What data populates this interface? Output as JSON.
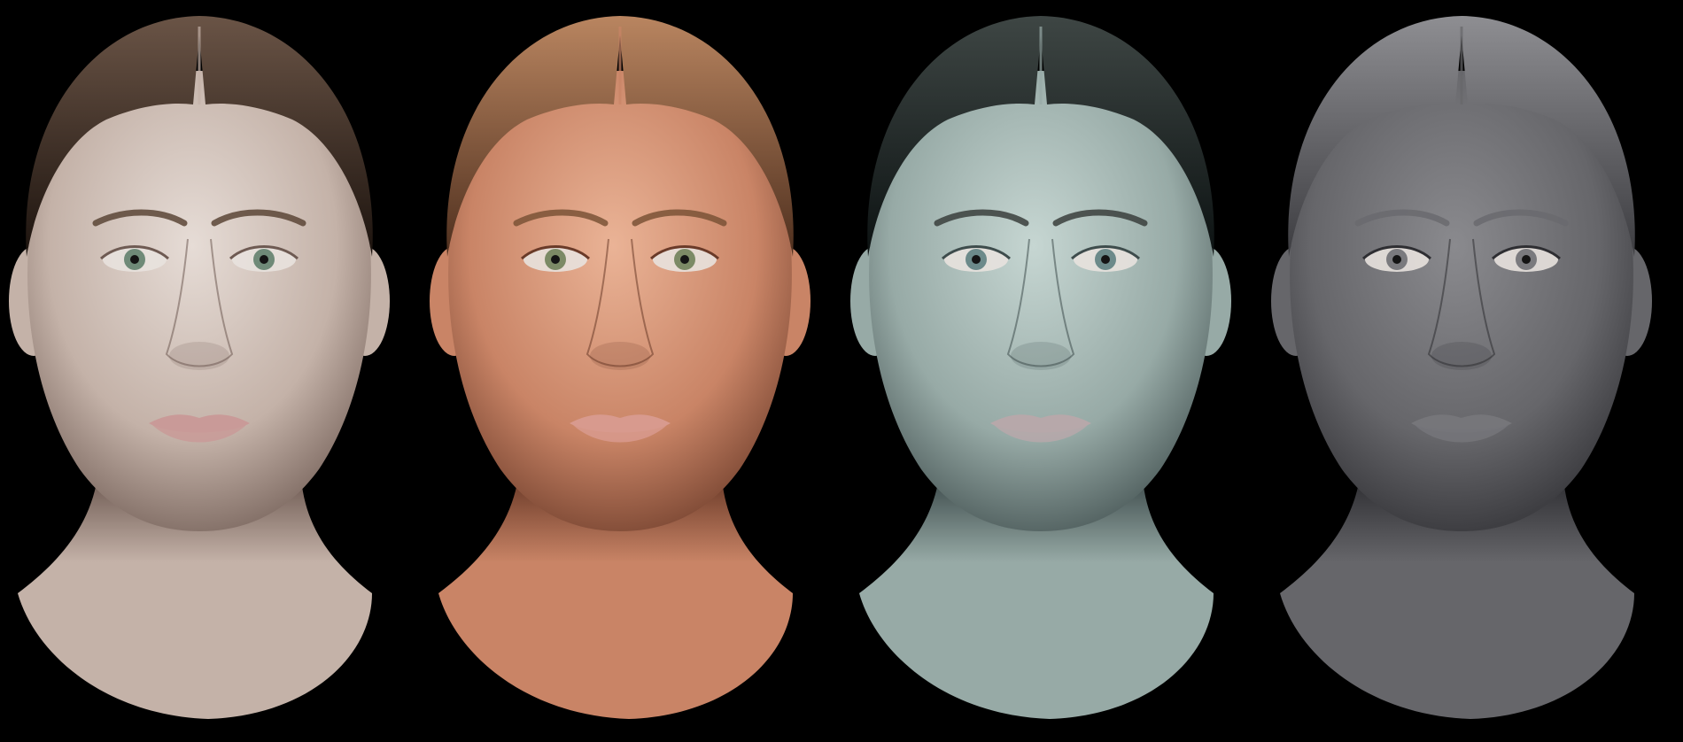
{
  "scene": {
    "background_color": "#000000",
    "panels": [
      {
        "variant": "neutral-lit",
        "skin_light": "#e6dcd6",
        "skin_mid": "#c4b2a8",
        "skin_dark": "#6e5a52",
        "hair_light": "#6a5446",
        "hair_dark": "#1c130e",
        "lip": "#c99a98",
        "iris": "#6f8a78",
        "brow": "#5a4536"
      },
      {
        "variant": "warm-lit",
        "skin_light": "#eab396",
        "skin_mid": "#c98466",
        "skin_dark": "#6a3a28",
        "hair_light": "#b98560",
        "hair_dark": "#4e2f1e",
        "lip": "#d89a8e",
        "iris": "#7c8a66",
        "brow": "#7a5236"
      },
      {
        "variant": "cool-lit",
        "skin_light": "#c6d6d2",
        "skin_mid": "#97aaa6",
        "skin_dark": "#3e4c4c",
        "hair_light": "#3e4644",
        "hair_dark": "#0c1212",
        "lip": "#b7a8aa",
        "iris": "#6c8a8a",
        "brow": "#3a3e3c"
      },
      {
        "variant": "clay-untextured",
        "skin_light": "#8a8a8e",
        "skin_mid": "#66666a",
        "skin_dark": "#2e2e32",
        "hair_light": "#8e8e92",
        "hair_dark": "#3c3c40",
        "lip": "#76767a",
        "iris": "#7a7a7e",
        "brow": "#6a6a6e"
      }
    ]
  }
}
